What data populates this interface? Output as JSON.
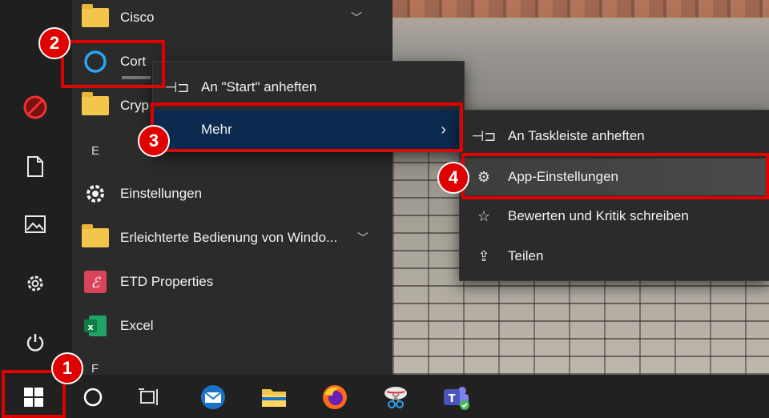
{
  "start_menu": {
    "rail": [
      {
        "name": "user-blocked-icon",
        "glyph": "⛔"
      },
      {
        "name": "documents-icon",
        "glyph": "🗋"
      },
      {
        "name": "pictures-icon",
        "glyph": "🖼"
      },
      {
        "name": "settings-icon",
        "glyph": "⚙"
      },
      {
        "name": "power-icon",
        "glyph": "⏻"
      }
    ],
    "apps": {
      "cisco": "Cisco",
      "cortana": "Cort",
      "crypto": "Cryp",
      "section_e": "E",
      "einstellungen": "Einstellungen",
      "erleichterte": "Erleichterte Bedienung von Windo...",
      "etd": "ETD Properties",
      "excel": "Excel",
      "section_f": "F"
    }
  },
  "context_menu": {
    "pin_start": "An \"Start\" anheften",
    "more": "Mehr"
  },
  "submenu": {
    "pin_taskbar": "An Taskleiste anheften",
    "app_settings": "App-Einstellungen",
    "rate_review": "Bewerten und Kritik schreiben",
    "share": "Teilen"
  },
  "badges": {
    "b1": "1",
    "b2": "2",
    "b3": "3",
    "b4": "4"
  },
  "colors": {
    "highlight": "#e00000",
    "accent": "#0a2a4f",
    "folder": "#f3c54a"
  }
}
